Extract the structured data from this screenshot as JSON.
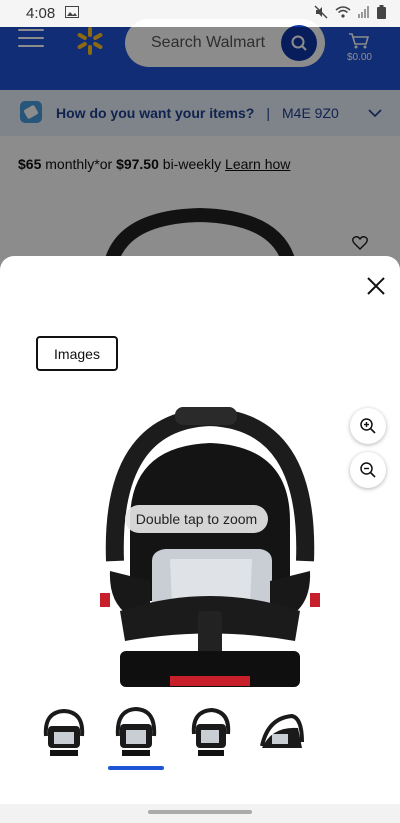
{
  "status_bar": {
    "time": "4:08"
  },
  "header": {
    "search_placeholder": "Search Walmart",
    "cart_total": "$0.00"
  },
  "delivery": {
    "message": "How do you want your items?",
    "separator": "|",
    "postal_code": "M4E 9Z0"
  },
  "pricing": {
    "monthly_amount": "$65",
    "monthly_text": " monthly*or ",
    "biweekly_amount": "$97.50",
    "biweekly_text": " bi-weekly ",
    "learn_link": "Learn how"
  },
  "modal": {
    "tab_label": "Images",
    "zoom_hint": "Double tap to zoom",
    "thumbnail_count": 4,
    "selected_thumbnail": 2
  },
  "colors": {
    "brand_blue": "#1f53d6",
    "brand_yellow": "#ffc220"
  }
}
